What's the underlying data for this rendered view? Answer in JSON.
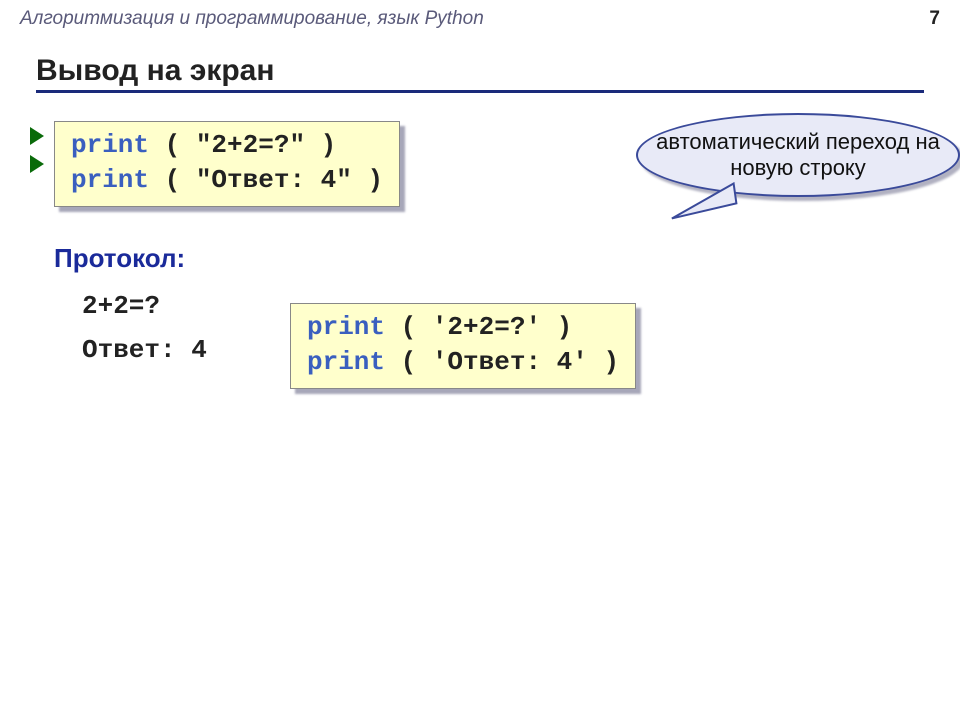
{
  "header": {
    "topic": "Алгоритмизация и программирование, язык Python",
    "page": "7"
  },
  "title": "Вывод на экран",
  "code1": {
    "line1_kw": "print",
    "line1_rest": " ( \"2+2=?\" )",
    "line2_kw": "print",
    "line2_rest": " ( \"Ответ: 4\" )"
  },
  "callout": "автоматический переход на новую строку",
  "protocol_label": "Протокол:",
  "output": {
    "line1": "2+2=?",
    "line2": "Ответ: 4"
  },
  "code2": {
    "line1_kw": "print",
    "line1_rest": " ( '2+2=?' )",
    "line2_kw": "print",
    "line2_rest": " ( 'Ответ: 4' )"
  }
}
